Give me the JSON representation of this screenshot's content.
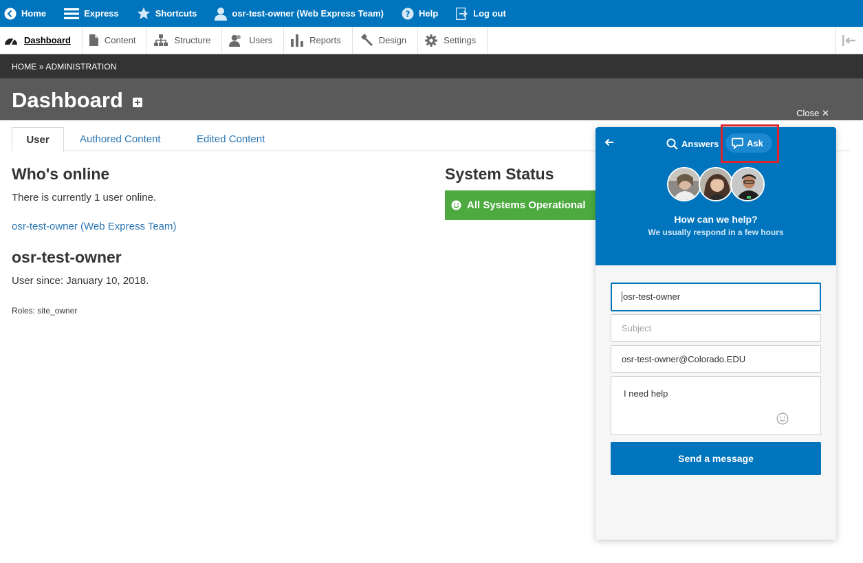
{
  "toolbar": {
    "home": "Home",
    "express": "Express",
    "shortcuts": "Shortcuts",
    "user": "osr-test-owner (Web Express Team)",
    "help": "Help",
    "logout": "Log out"
  },
  "tray": {
    "items": [
      "Dashboard",
      "Content",
      "Structure",
      "Users",
      "Reports",
      "Design",
      "Settings"
    ]
  },
  "breadcrumb": "HOME » ADMINISTRATION",
  "page_title": "Dashboard",
  "tabs": [
    "User",
    "Authored Content",
    "Edited Content"
  ],
  "whos_online": {
    "heading": "Who's online",
    "text": "There is currently 1 user online.",
    "user_link": "osr-test-owner (Web Express Team)"
  },
  "profile": {
    "name": "osr-test-owner",
    "since": "User since: January 10, 2018.",
    "roles": "Roles: site_owner"
  },
  "system_status": {
    "heading": "System Status",
    "badge": "All Systems Operational"
  },
  "chat": {
    "close": "Close ✕",
    "tab_answers": "Answers",
    "tab_ask": "Ask",
    "help_title": "How can we help?",
    "help_sub": "We usually respond in a few hours",
    "name_value": "osr-test-owner",
    "subject_placeholder": "Subject",
    "email_value": "osr-test-owner@Colorado.EDU",
    "message_value": "I need help",
    "send": "Send a message"
  },
  "colors": {
    "brand_blue": "#0074bd",
    "status_green": "#4caa3f",
    "highlight_red": "#d9252e"
  }
}
